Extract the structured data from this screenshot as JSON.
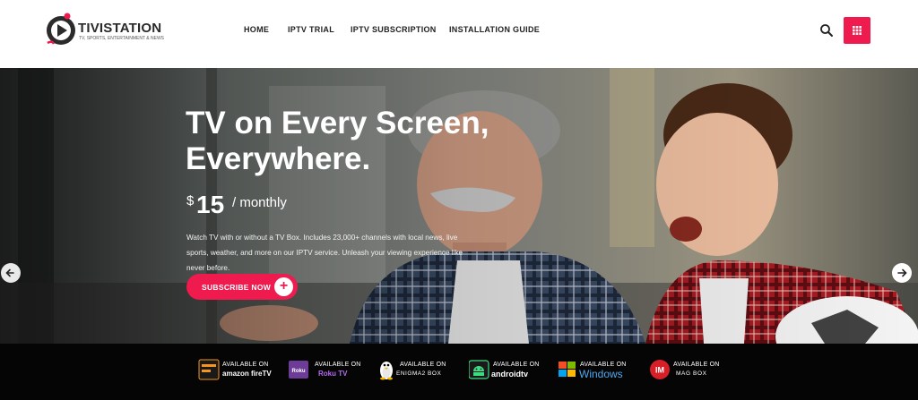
{
  "brand": {
    "name": "TIVISTATION",
    "tagline": "TV, SPORTS, ENTERTAINMENT & NEWS",
    "accent": "#ef1a4d"
  },
  "nav": {
    "items": [
      {
        "label": "HOME"
      },
      {
        "label": "IPTV TRIAL"
      },
      {
        "label": "IPTV SUBSCRIPTION"
      },
      {
        "label": "INSTALLATION GUIDE"
      }
    ],
    "search_icon": "search-icon",
    "menu_icon": "grid-icon"
  },
  "hero": {
    "title_line1": "TV on Every Screen,",
    "title_line2": "Everywhere.",
    "price_currency": "$",
    "price_amount": "15",
    "price_period": "/ monthly",
    "description": "Watch TV with or without a TV Box. Includes 23,000+ channels with local news, live sports, weather, and more on our IPTV service. Unleash your viewing experience like never before.",
    "cta_label": "SUBSCRIBE NOW",
    "cta_icon": "plus-icon",
    "prev_icon": "arrow-left-icon",
    "next_icon": "arrow-right-icon"
  },
  "platforms": [
    {
      "available": "AVAILABLE ON",
      "name": "amazon fireTV",
      "icon": "amazon-firetv-icon"
    },
    {
      "available": "AVAILABLE ON",
      "name": "Roku TV",
      "icon": "roku-icon"
    },
    {
      "available": "AVAILABLE ON",
      "name": "ENIGMA2 BOX",
      "icon": "linux-tux-icon"
    },
    {
      "available": "AVAILABLE ON",
      "name": "androidtv",
      "icon": "android-icon"
    },
    {
      "available": "AVAILABLE ON",
      "name": "Windows",
      "icon": "windows-icon"
    },
    {
      "available": "AVAILABLE ON",
      "name": "MAG BOX",
      "icon": "mag-icon"
    }
  ]
}
